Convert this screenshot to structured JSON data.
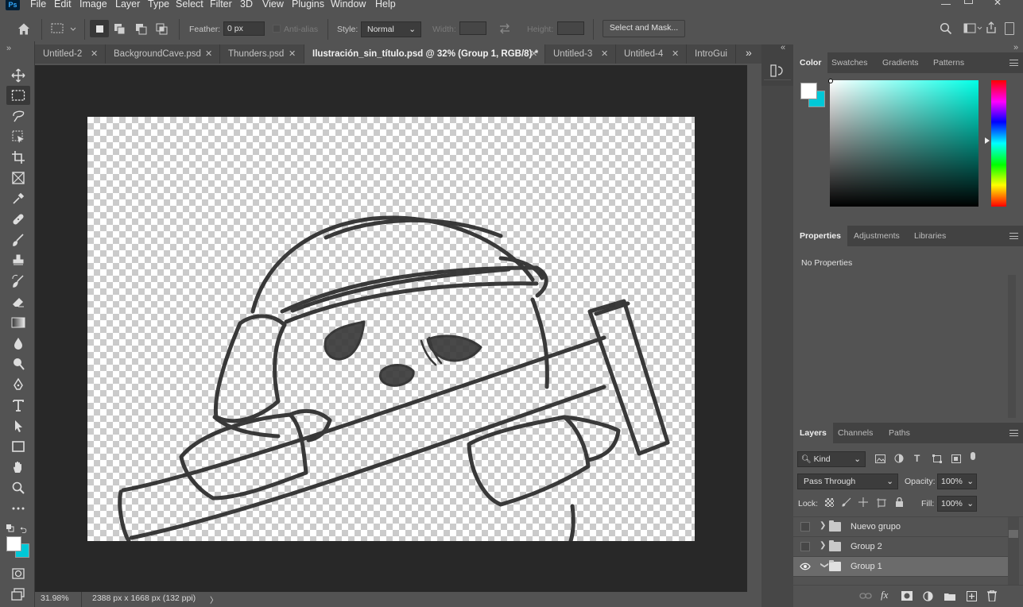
{
  "app": {
    "logo": "Ps"
  },
  "menu": [
    "File",
    "Edit",
    "Image",
    "Layer",
    "Type",
    "Select",
    "Filter",
    "3D",
    "View",
    "Plugins",
    "Window",
    "Help"
  ],
  "options": {
    "feather_label": "Feather:",
    "feather_value": "0 px",
    "antialias_label": "Anti-alias",
    "style_label": "Style:",
    "style_value": "Normal",
    "width_label": "Width:",
    "height_label": "Height:",
    "select_mask_label": "Select and Mask..."
  },
  "tabs": [
    {
      "label": "Untitled-2",
      "active": false
    },
    {
      "label": "BackgroundCave.psd",
      "active": false
    },
    {
      "label": "Thunders.psd",
      "active": false
    },
    {
      "label": "Ilustración_sin_título.psd @ 32% (Group 1, RGB/8) *",
      "active": true
    },
    {
      "label": "Untitled-3",
      "active": false
    },
    {
      "label": "Untitled-4",
      "active": false
    },
    {
      "label": "IntroGui",
      "active": false
    }
  ],
  "tab_overflow": "»",
  "status": {
    "zoom": "31.98%",
    "doc_info": "2388 px x 1668 px (132 ppi)",
    "arrow": "〉"
  },
  "color_panel": {
    "tabs": [
      "Color",
      "Swatches",
      "Gradients",
      "Patterns"
    ],
    "foreground": "#ffffff",
    "background": "#00c8d7",
    "hue": "#00ffe6"
  },
  "properties_panel": {
    "tabs": [
      "Properties",
      "Adjustments",
      "Libraries"
    ],
    "empty_text": "No Properties"
  },
  "layers_panel": {
    "tabs": [
      "Layers",
      "Channels",
      "Paths"
    ],
    "filter_kind": "Kind",
    "blend_mode": "Pass Through",
    "opacity_label": "Opacity:",
    "opacity_value": "100%",
    "lock_label": "Lock:",
    "fill_label": "Fill:",
    "fill_value": "100%",
    "layers": [
      {
        "name": "Nuevo grupo",
        "visible": false,
        "expanded": false,
        "selected": false
      },
      {
        "name": "Group 2",
        "visible": false,
        "expanded": false,
        "selected": false
      },
      {
        "name": "Group 1",
        "visible": true,
        "expanded": true,
        "selected": true
      }
    ]
  },
  "icons": {
    "toolbar": [
      "move-icon",
      "marquee-icon",
      "lasso-icon",
      "object-select-icon",
      "crop-icon",
      "frame-icon",
      "eyedropper-icon",
      "healing-icon",
      "brush-icon",
      "stamp-icon",
      "history-brush-icon",
      "eraser-icon",
      "gradient-icon",
      "blur-icon",
      "dodge-icon",
      "pen-icon",
      "type-icon",
      "path-select-icon",
      "rectangle-icon",
      "hand-icon",
      "zoom-icon",
      "more-tools-icon"
    ],
    "colors": {
      "accent": "#31a8ff",
      "ui_dark": "#282828",
      "ui_mid": "#535353"
    }
  }
}
